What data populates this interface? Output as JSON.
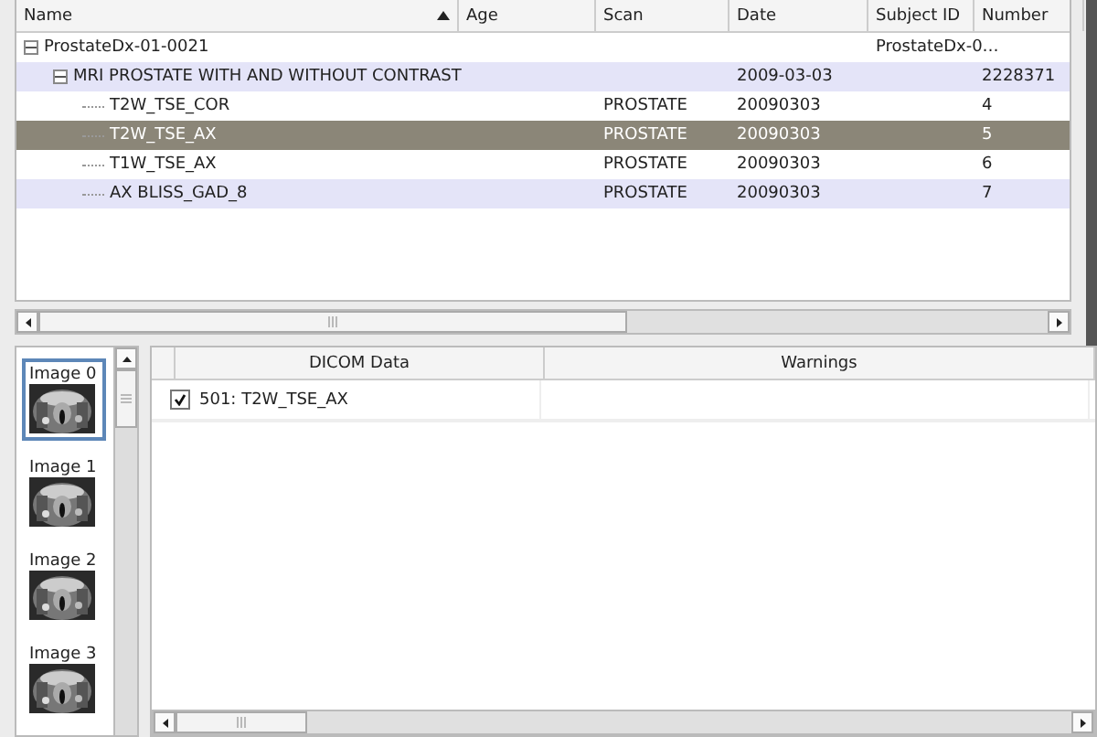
{
  "tree_table": {
    "columns": [
      {
        "label": "Name",
        "sorted": true
      },
      {
        "label": "Age",
        "sorted": false
      },
      {
        "label": "Scan",
        "sorted": false
      },
      {
        "label": "Date",
        "sorted": false
      },
      {
        "label": "Subject ID",
        "sorted": false
      },
      {
        "label": "Number",
        "sorted": false
      }
    ],
    "rows": [
      {
        "cells": [
          "ProstateDx-01-0021",
          "",
          "",
          "",
          "ProstateDx-0…",
          ""
        ],
        "expanded": true,
        "selected": false,
        "children": [
          {
            "cells": [
              "MRI PROSTATE WITH AND WITHOUT CONTRAST",
              "",
              "",
              "2009-03-03",
              "",
              "2228371"
            ],
            "expanded": true,
            "selected": false,
            "children": [
              {
                "cells": [
                  "T2W_TSE_COR",
                  "",
                  "PROSTATE",
                  "20090303",
                  "",
                  "4"
                ],
                "selected": false
              },
              {
                "cells": [
                  "T2W_TSE_AX",
                  "",
                  "PROSTATE",
                  "20090303",
                  "",
                  "5"
                ],
                "selected": true
              },
              {
                "cells": [
                  "T1W_TSE_AX",
                  "",
                  "PROSTATE",
                  "20090303",
                  "",
                  "6"
                ],
                "selected": false
              },
              {
                "cells": [
                  "AX BLISS_GAD_8",
                  "",
                  "PROSTATE",
                  "20090303",
                  "",
                  "7"
                ],
                "selected": false
              }
            ]
          }
        ]
      }
    ]
  },
  "thumbnails": [
    {
      "label": "Image 0",
      "selected": true
    },
    {
      "label": "Image 1",
      "selected": false
    },
    {
      "label": "Image 2",
      "selected": false
    },
    {
      "label": "Image 3",
      "selected": false
    }
  ],
  "dicom_table": {
    "columns": [
      "DICOM Data",
      "Warnings"
    ],
    "rows": [
      {
        "label": "501: T2W_TSE_AX",
        "checked": true,
        "warning": ""
      }
    ]
  }
}
